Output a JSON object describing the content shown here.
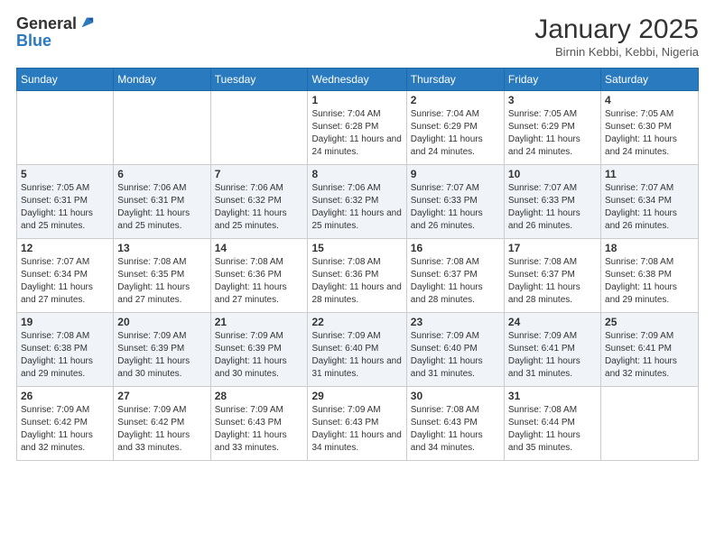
{
  "logo": {
    "general": "General",
    "blue": "Blue"
  },
  "header": {
    "title": "January 2025",
    "location": "Birnin Kebbi, Kebbi, Nigeria"
  },
  "weekdays": [
    "Sunday",
    "Monday",
    "Tuesday",
    "Wednesday",
    "Thursday",
    "Friday",
    "Saturday"
  ],
  "weeks": [
    [
      {
        "day": "",
        "info": ""
      },
      {
        "day": "",
        "info": ""
      },
      {
        "day": "",
        "info": ""
      },
      {
        "day": "1",
        "info": "Sunrise: 7:04 AM\nSunset: 6:28 PM\nDaylight: 11 hours and 24 minutes."
      },
      {
        "day": "2",
        "info": "Sunrise: 7:04 AM\nSunset: 6:29 PM\nDaylight: 11 hours and 24 minutes."
      },
      {
        "day": "3",
        "info": "Sunrise: 7:05 AM\nSunset: 6:29 PM\nDaylight: 11 hours and 24 minutes."
      },
      {
        "day": "4",
        "info": "Sunrise: 7:05 AM\nSunset: 6:30 PM\nDaylight: 11 hours and 24 minutes."
      }
    ],
    [
      {
        "day": "5",
        "info": "Sunrise: 7:05 AM\nSunset: 6:31 PM\nDaylight: 11 hours and 25 minutes."
      },
      {
        "day": "6",
        "info": "Sunrise: 7:06 AM\nSunset: 6:31 PM\nDaylight: 11 hours and 25 minutes."
      },
      {
        "day": "7",
        "info": "Sunrise: 7:06 AM\nSunset: 6:32 PM\nDaylight: 11 hours and 25 minutes."
      },
      {
        "day": "8",
        "info": "Sunrise: 7:06 AM\nSunset: 6:32 PM\nDaylight: 11 hours and 25 minutes."
      },
      {
        "day": "9",
        "info": "Sunrise: 7:07 AM\nSunset: 6:33 PM\nDaylight: 11 hours and 26 minutes."
      },
      {
        "day": "10",
        "info": "Sunrise: 7:07 AM\nSunset: 6:33 PM\nDaylight: 11 hours and 26 minutes."
      },
      {
        "day": "11",
        "info": "Sunrise: 7:07 AM\nSunset: 6:34 PM\nDaylight: 11 hours and 26 minutes."
      }
    ],
    [
      {
        "day": "12",
        "info": "Sunrise: 7:07 AM\nSunset: 6:34 PM\nDaylight: 11 hours and 27 minutes."
      },
      {
        "day": "13",
        "info": "Sunrise: 7:08 AM\nSunset: 6:35 PM\nDaylight: 11 hours and 27 minutes."
      },
      {
        "day": "14",
        "info": "Sunrise: 7:08 AM\nSunset: 6:36 PM\nDaylight: 11 hours and 27 minutes."
      },
      {
        "day": "15",
        "info": "Sunrise: 7:08 AM\nSunset: 6:36 PM\nDaylight: 11 hours and 28 minutes."
      },
      {
        "day": "16",
        "info": "Sunrise: 7:08 AM\nSunset: 6:37 PM\nDaylight: 11 hours and 28 minutes."
      },
      {
        "day": "17",
        "info": "Sunrise: 7:08 AM\nSunset: 6:37 PM\nDaylight: 11 hours and 28 minutes."
      },
      {
        "day": "18",
        "info": "Sunrise: 7:08 AM\nSunset: 6:38 PM\nDaylight: 11 hours and 29 minutes."
      }
    ],
    [
      {
        "day": "19",
        "info": "Sunrise: 7:08 AM\nSunset: 6:38 PM\nDaylight: 11 hours and 29 minutes."
      },
      {
        "day": "20",
        "info": "Sunrise: 7:09 AM\nSunset: 6:39 PM\nDaylight: 11 hours and 30 minutes."
      },
      {
        "day": "21",
        "info": "Sunrise: 7:09 AM\nSunset: 6:39 PM\nDaylight: 11 hours and 30 minutes."
      },
      {
        "day": "22",
        "info": "Sunrise: 7:09 AM\nSunset: 6:40 PM\nDaylight: 11 hours and 31 minutes."
      },
      {
        "day": "23",
        "info": "Sunrise: 7:09 AM\nSunset: 6:40 PM\nDaylight: 11 hours and 31 minutes."
      },
      {
        "day": "24",
        "info": "Sunrise: 7:09 AM\nSunset: 6:41 PM\nDaylight: 11 hours and 31 minutes."
      },
      {
        "day": "25",
        "info": "Sunrise: 7:09 AM\nSunset: 6:41 PM\nDaylight: 11 hours and 32 minutes."
      }
    ],
    [
      {
        "day": "26",
        "info": "Sunrise: 7:09 AM\nSunset: 6:42 PM\nDaylight: 11 hours and 32 minutes."
      },
      {
        "day": "27",
        "info": "Sunrise: 7:09 AM\nSunset: 6:42 PM\nDaylight: 11 hours and 33 minutes."
      },
      {
        "day": "28",
        "info": "Sunrise: 7:09 AM\nSunset: 6:43 PM\nDaylight: 11 hours and 33 minutes."
      },
      {
        "day": "29",
        "info": "Sunrise: 7:09 AM\nSunset: 6:43 PM\nDaylight: 11 hours and 34 minutes."
      },
      {
        "day": "30",
        "info": "Sunrise: 7:08 AM\nSunset: 6:43 PM\nDaylight: 11 hours and 34 minutes."
      },
      {
        "day": "31",
        "info": "Sunrise: 7:08 AM\nSunset: 6:44 PM\nDaylight: 11 hours and 35 minutes."
      },
      {
        "day": "",
        "info": ""
      }
    ]
  ]
}
